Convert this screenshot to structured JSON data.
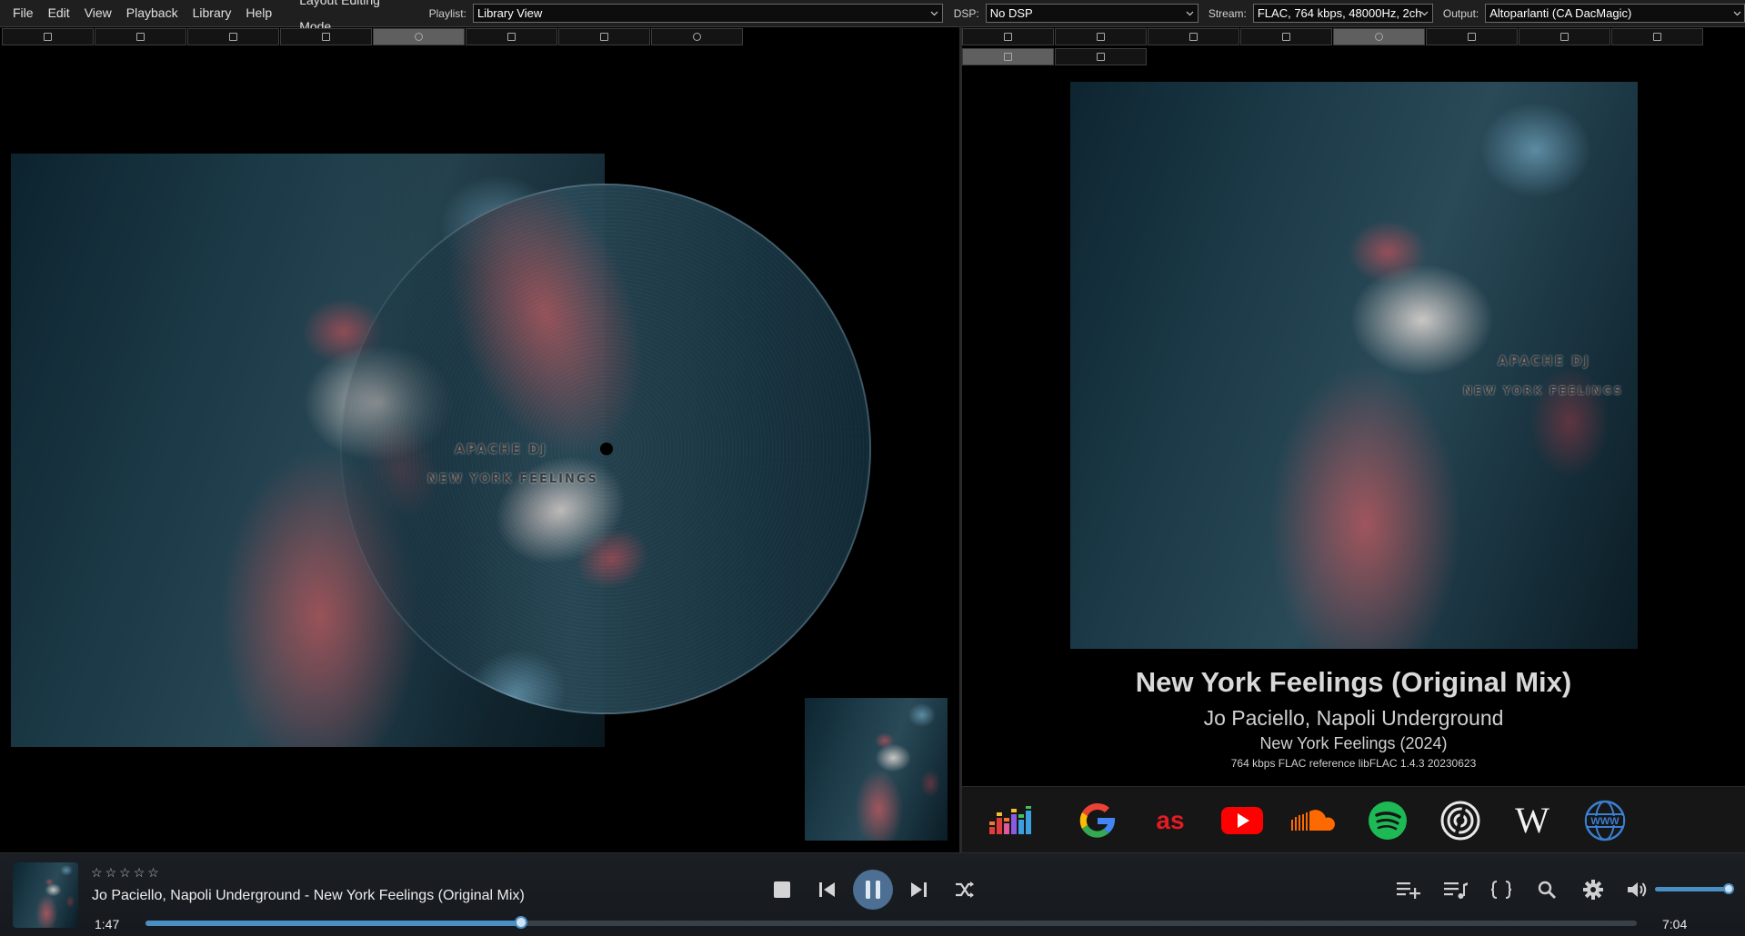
{
  "menu": [
    "File",
    "Edit",
    "View",
    "Playback",
    "Library",
    "Help",
    "Layout Editing Mode"
  ],
  "toolbar": {
    "playlist_label": "Playlist:",
    "playlist_value": "Library View",
    "dsp_label": "DSP:",
    "dsp_value": "No DSP",
    "stream_label": "Stream:",
    "stream_value": "FLAC, 764 kbps, 48000Hz, 2ch",
    "output_label": "Output:",
    "output_value": "Altoparlanti (CA DacMagic)"
  },
  "art_text": {
    "artist": "APACHE DJ",
    "title": "NEW YORK FEELINGS"
  },
  "track_info": {
    "title": "New York Feelings (Original Mix)",
    "artists": "Jo Paciello, Napoli Underground",
    "album": "New York Feelings (2024)",
    "codec": "764 kbps FLAC reference libFLAC 1.4.3 20230623"
  },
  "services": [
    "equalizer-icon",
    "google-icon",
    "lastfm-icon",
    "youtube-icon",
    "soundcloud-icon",
    "spotify-icon",
    "discogs-icon",
    "wikipedia-icon",
    "www-icon"
  ],
  "player": {
    "stars": [
      "☆",
      "☆",
      "☆",
      "☆",
      "☆"
    ],
    "now_playing": "Jo Paciello, Napoli Underground - New York Feelings (Original Mix)",
    "elapsed": "1:47",
    "duration": "7:04",
    "progress": 0.252,
    "volume": 0.96
  },
  "colors": {
    "accent": "#4a8fc4",
    "pause_bg": "#4d6f93"
  }
}
